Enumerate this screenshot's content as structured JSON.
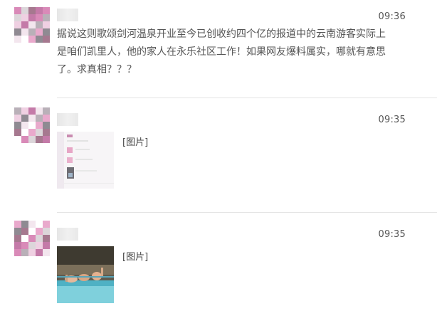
{
  "messages": [
    {
      "time": "09:36",
      "text": "据说这则歌颂剑河温泉开业至今已创收约四个亿的报道中的云南游客实际上是咱们凯里人，他的家人在永乐社区工作！如果网友爆料属实，哪就有意思了。求真相？？？"
    },
    {
      "time": "09:35",
      "image_label": "[图片]"
    },
    {
      "time": "09:35",
      "image_label": "[图片]"
    }
  ],
  "colors": {
    "background": "#ffffff",
    "divider": "#e4e4e4",
    "text": "#555555",
    "avatar_pink": "#d98ab8"
  }
}
